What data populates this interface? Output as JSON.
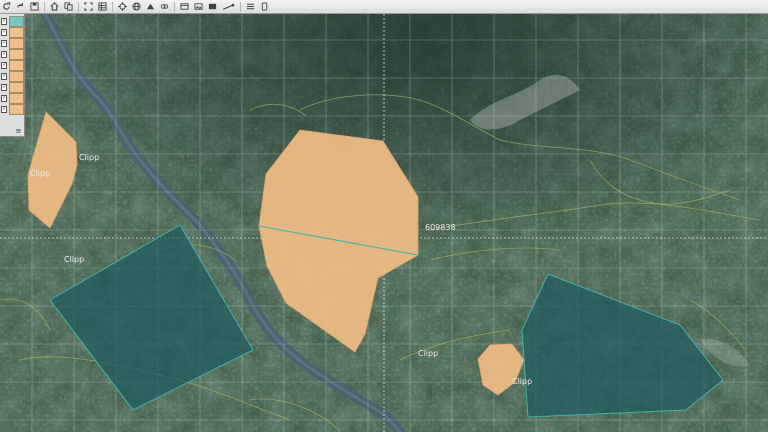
{
  "toolbar": {
    "icons": [
      "refresh-icon",
      "redo-icon",
      "save-icon",
      "home-icon",
      "copy-icon",
      "extent-icon",
      "table-icon",
      "locate-icon",
      "globe-icon",
      "upload-icon",
      "link-icon",
      "window-icon",
      "picture-icon",
      "message-icon",
      "measure-icon",
      "menu-icon",
      "page-icon"
    ]
  },
  "layer_panel": {
    "swatch_colors": [
      "#74c6c9",
      "#f0c08c",
      "#f0c08c",
      "#f0c08c",
      "#f0c08c",
      "#f0c08c",
      "#f0c08c",
      "#f0c08c",
      "#f0c08c"
    ]
  },
  "map": {
    "colors": {
      "orange_fill": "#f0bd85",
      "teal_fill": "#1f5a5e",
      "teal_stroke": "#3fb5a6",
      "contour": "#a6b65a",
      "river": "#49606d",
      "grid": "#dfe6e0"
    },
    "labels": {
      "clip_1": "Clipp",
      "clip_2": "Clipp",
      "clip_3": "Clipp",
      "clip_4": "Clipp",
      "clip_5": "Clipp",
      "area_value": "609838"
    }
  }
}
